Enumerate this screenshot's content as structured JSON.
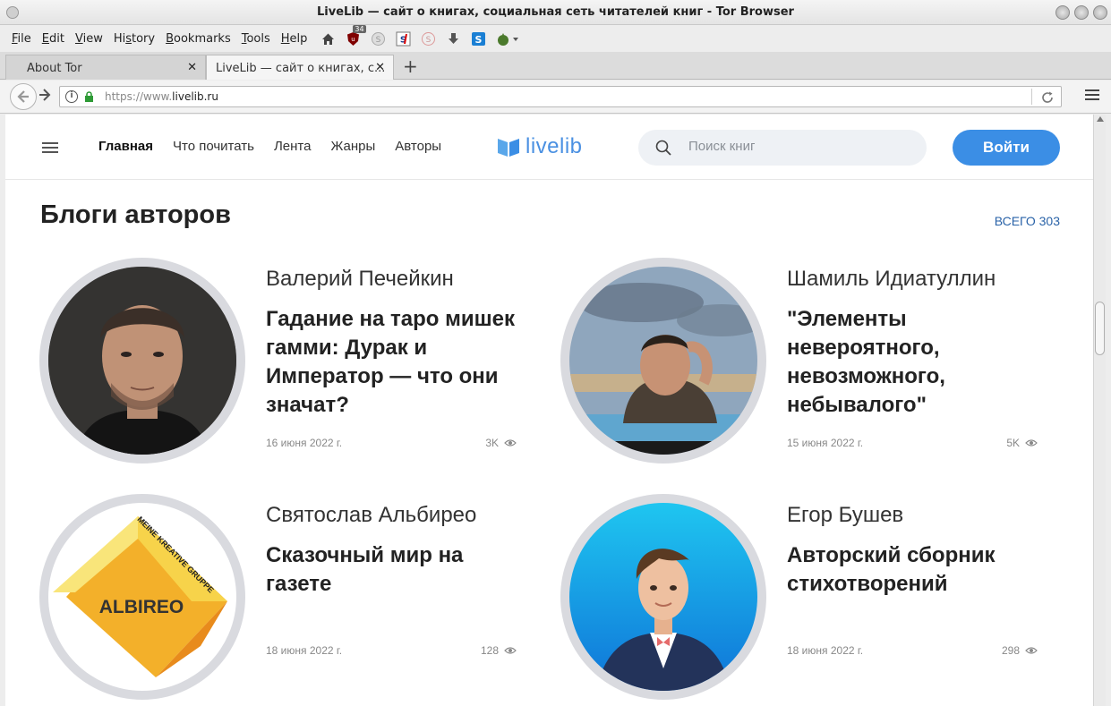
{
  "window": {
    "title": "LiveLib — сайт о книгах, социальная сеть читателей книг - Tor Browser"
  },
  "menu": [
    {
      "label": "File"
    },
    {
      "label": "Edit"
    },
    {
      "label": "View"
    },
    {
      "label": "History"
    },
    {
      "label": "Bookmarks"
    },
    {
      "label": "Tools"
    },
    {
      "label": "Help"
    }
  ],
  "toolbar": {
    "ublock_badge": "34",
    "icons": [
      "home-icon",
      "ublock-icon",
      "privacy-icon",
      "noscript-icon",
      "disabled-icon",
      "download-icon",
      "s-extension-icon",
      "tor-onion-icon"
    ]
  },
  "tabs": [
    {
      "label": "About Tor",
      "close": "✕"
    },
    {
      "label": "LiveLib — сайт о книгах, с...",
      "close": "✕"
    }
  ],
  "newtab_label": "+",
  "address": {
    "prefix": "https://www.",
    "domain": "livelib.ru"
  },
  "site": {
    "nav": [
      "Главная",
      "Что почитать",
      "Лента",
      "Жанры",
      "Авторы"
    ],
    "logo": "livelib",
    "search_placeholder": "Поиск книг",
    "login": "Войти",
    "section_title": "Блоги авторов",
    "total": "ВСЕГО 303",
    "posts": [
      {
        "author": "Валерий Печейкин",
        "title": "Гадание на таро мишек гамми: Дурак и Император — что они значат?",
        "date": "16 июня 2022 г.",
        "views": "3K"
      },
      {
        "author": "Шамиль Идиатуллин",
        "title": "\"Элементы невероятного, невозможного, небывалого\"",
        "date": "15 июня 2022 г.",
        "views": "5K"
      },
      {
        "author": "Святослав Альбирео",
        "title": "Сказочный мир на газете",
        "date": "18 июня 2022 г.",
        "views": "128",
        "logo_text": "ALBIREO",
        "logo_caption": "MEINE KREATIVE GRUPPE"
      },
      {
        "author": "Егор Бушев",
        "title": "Авторский сборник стихотворений",
        "date": "18 июня 2022 г.",
        "views": "298"
      }
    ]
  },
  "colors": {
    "accent": "#3b8ee5",
    "logo": "#4a90e2",
    "link": "#2a63a8"
  }
}
